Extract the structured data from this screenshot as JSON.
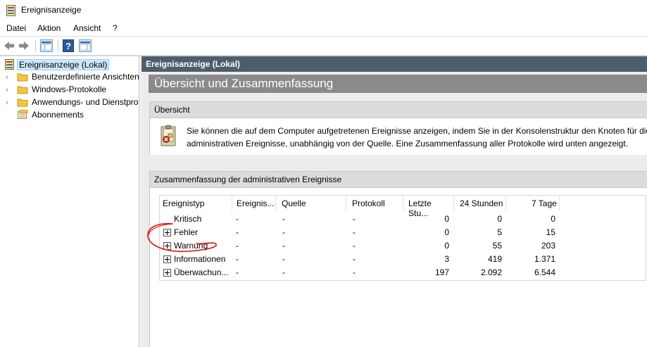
{
  "window": {
    "title": "Ereignisanzeige"
  },
  "menu": {
    "items": [
      "Datei",
      "Aktion",
      "Ansicht",
      "?"
    ]
  },
  "toolbar": {
    "buttons": [
      "back-arrow-icon",
      "forward-arrow-icon",
      "console-tree-icon",
      "help-icon",
      "action-pane-icon"
    ]
  },
  "tree": {
    "root": "Ereignisanzeige (Lokal)",
    "items": [
      {
        "label": "Benutzerdefinierte Ansichten",
        "icon": "folder-icon",
        "expandable": true
      },
      {
        "label": "Windows-Protokolle",
        "icon": "folder-icon",
        "expandable": true
      },
      {
        "label": "Anwendungs- und Dienstprotokolle",
        "icon": "folder-icon",
        "expandable": true
      },
      {
        "label": "Abonnements",
        "icon": "subscriptions-icon",
        "expandable": false
      }
    ]
  },
  "pane": {
    "header": "Ereignisanzeige (Lokal)",
    "title": "Übersicht und Zusammenfassung",
    "overview": {
      "heading": "Übersicht",
      "text_line1": "Sie können die auf dem Computer aufgetretenen Ereignisse anzeigen, indem Sie in der Konsolenstruktur den Knoten für die C",
      "text_line2": "administrativen Ereignisse, unabhängig von der Quelle. Eine Zusammenfassung aller Protokolle wird unten angezeigt."
    },
    "summary": {
      "heading": "Zusammenfassung der administrativen Ereignisse",
      "columns": [
        "Ereignistyp",
        "Ereignis...",
        "Quelle",
        "Protokoll",
        "Letzte Stu...",
        "24 Stunden",
        "7 Tage"
      ],
      "rows": [
        {
          "type": "Kritisch",
          "id": "-",
          "source": "-",
          "log": "-",
          "last_hour": "0",
          "h24": "0",
          "d7": "0",
          "expandable": false
        },
        {
          "type": "Fehler",
          "id": "-",
          "source": "-",
          "log": "-",
          "last_hour": "0",
          "h24": "5",
          "d7": "15",
          "expandable": true
        },
        {
          "type": "Warnung",
          "id": "-",
          "source": "-",
          "log": "-",
          "last_hour": "0",
          "h24": "55",
          "d7": "203",
          "expandable": true
        },
        {
          "type": "Informationen",
          "id": "-",
          "source": "-",
          "log": "-",
          "last_hour": "3",
          "h24": "419",
          "d7": "1.371",
          "expandable": true
        },
        {
          "type": "Überwachun...",
          "id": "-",
          "source": "-",
          "log": "-",
          "last_hour": "197",
          "h24": "2.092",
          "d7": "6.544",
          "expandable": true
        }
      ]
    }
  },
  "colors": {
    "pane_header_bg": "#4e5d6e",
    "title_bar_bg": "#8a8a8a",
    "selection_bg": "#cce8ff",
    "annotation_red": "#e01010"
  }
}
